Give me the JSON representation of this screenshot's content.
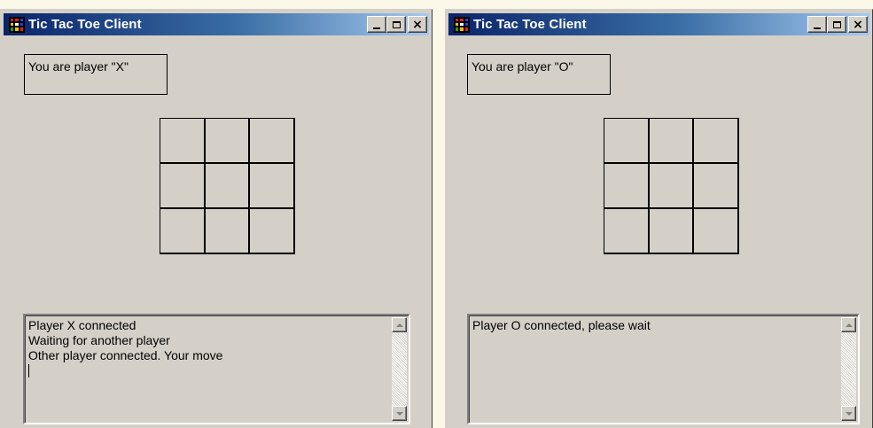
{
  "windows": [
    {
      "title": "Tic Tac Toe Client",
      "player_label": "You are player \"X\"",
      "log_lines": [
        "Player X connected",
        "Waiting for another player",
        "Other player connected. Your move"
      ]
    },
    {
      "title": "Tic Tac Toe Client",
      "player_label": "You are player \"O\"",
      "log_lines": [
        "Player O connected, please wait"
      ]
    }
  ],
  "titlebar_buttons": {
    "minimize": "_",
    "maximize": "□",
    "close": "×"
  },
  "icons": [
    "app-icon",
    "minimize-icon",
    "maximize-icon",
    "close-icon",
    "scroll-up-arrow-icon",
    "scroll-down-arrow-icon"
  ],
  "colors": {
    "titlebar_start": "#0a246a",
    "titlebar_end": "#a6caf0",
    "window_bg": "#d4d0c8",
    "desktop_bg": "#fcf8e9"
  }
}
